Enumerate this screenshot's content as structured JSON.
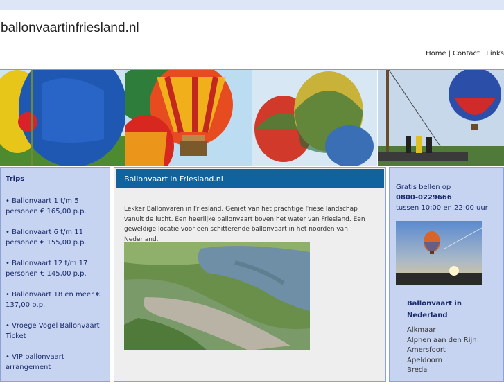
{
  "site": {
    "title": "ballonvaartinfriesland.nl"
  },
  "nav": {
    "home": "Home",
    "contact": "Contact",
    "links": "Links",
    "sep": "|"
  },
  "trips": {
    "title": "Trips",
    "items": [
      "• Ballonvaart 1 t/m 5 personen € 165,00 p.p.",
      "• Ballonvaart 6 t/m 11 personen € 155,00 p.p.",
      "• Ballonvaart 12 t/m 17 personen € 145,00 p.p.",
      "• Ballonvaart 18 en meer € 137,00 p.p.",
      "• Vroege Vogel Ballonvaart Ticket",
      "• VIP ballonvaart arrangement"
    ]
  },
  "main": {
    "heading": "Ballonvaart in Friesland.nl",
    "intro": "Lekker Ballonvaren in Friesland. Geniet van het prachtige Friese landschap vanuit de lucht. Een heerlijke ballonvaart boven het water van Friesland. Een geweldige locatie voor een schitterende ballonvaart in het noorden van Nederland."
  },
  "contact": {
    "line1": "Gratis bellen op",
    "phone": "0800-0229666",
    "hours": "tussen 10:00 en 22:00 uur"
  },
  "nederland": {
    "title": "Ballonvaart in Nederland",
    "cities": [
      "Alkmaar",
      "Alphen aan den Rijn",
      "Amersfoort",
      "Apeldoorn",
      "Breda"
    ]
  },
  "colors": {
    "header_bar": "#11639e",
    "sidebar_bg": "#c6d4f2",
    "top_strip": "#dce6f7",
    "main_bg": "#eeeeee"
  }
}
